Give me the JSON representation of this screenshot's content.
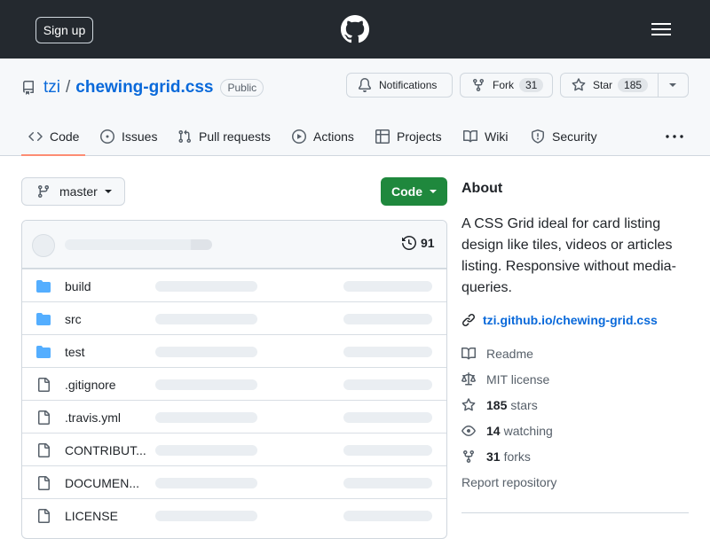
{
  "header": {
    "signup_label": "Sign up"
  },
  "repo": {
    "owner": "tzi",
    "separator": "/",
    "name": "chewing-grid.css",
    "visibility": "Public"
  },
  "actions": {
    "notifications_label": "Notifications",
    "fork_label": "Fork",
    "fork_count": "31",
    "star_label": "Star",
    "star_count": "185"
  },
  "tabs": [
    {
      "label": "Code",
      "icon": "code-icon",
      "active": true
    },
    {
      "label": "Issues",
      "icon": "issue-icon"
    },
    {
      "label": "Pull requests",
      "icon": "pull-request-icon"
    },
    {
      "label": "Actions",
      "icon": "play-icon"
    },
    {
      "label": "Projects",
      "icon": "table-icon"
    },
    {
      "label": "Wiki",
      "icon": "book-icon"
    },
    {
      "label": "Security",
      "icon": "shield-icon"
    }
  ],
  "branch": {
    "name": "master"
  },
  "code_button": {
    "label": "Code"
  },
  "commits": {
    "count": "91"
  },
  "files": [
    {
      "name": "build",
      "type": "dir"
    },
    {
      "name": "src",
      "type": "dir"
    },
    {
      "name": "test",
      "type": "dir"
    },
    {
      "name": ".gitignore",
      "type": "file"
    },
    {
      "name": ".travis.yml",
      "type": "file"
    },
    {
      "name": "CONTRIBUT...",
      "type": "file"
    },
    {
      "name": "DOCUMEN...",
      "type": "file"
    },
    {
      "name": "LICENSE",
      "type": "file"
    }
  ],
  "about": {
    "title": "About",
    "description": "A CSS Grid ideal for card listing design like tiles, videos or articles listing. Responsive without media-queries.",
    "link": "tzi.github.io/chewing-grid.css",
    "readme": "Readme",
    "license": "MIT license",
    "stars_count": "185",
    "stars_label": "stars",
    "watching_count": "14",
    "watching_label": "watching",
    "forks_count": "31",
    "forks_label": "forks",
    "report": "Report repository"
  },
  "colors": {
    "header_bg": "#24292f",
    "link": "#0969da",
    "primary_button": "#1f883d",
    "active_tab_underline": "#fd8c73",
    "folder_icon": "#54aeff"
  }
}
